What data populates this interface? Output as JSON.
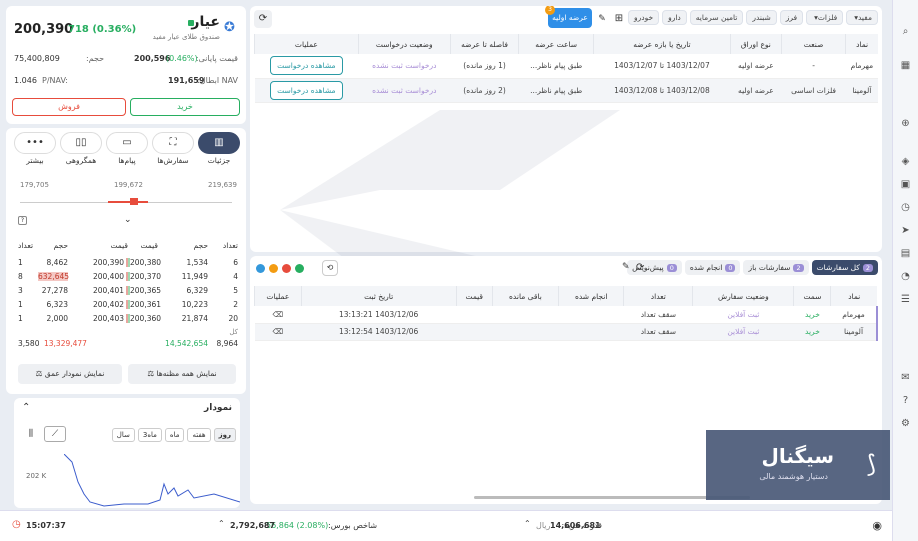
{
  "instrument": {
    "name": "عیار",
    "subtitle": "صندوق طلای عیار مفید",
    "price": "200,390",
    "change": "718 (0.36%)",
    "close_label": "قیمت پایانی:",
    "close_value": "200,596",
    "close_change": "(0.46%)",
    "volume_label": "حجم:",
    "volume_value": "75,400,809",
    "nav_label": "NAV ابطال:",
    "nav_value": "191,659",
    "pnav_label": "P/NAV:",
    "pnav_value": "1.046",
    "buy": "خرید",
    "sell": "فروش"
  },
  "tabs": [
    {
      "label": "جزئیات"
    },
    {
      "label": "سفارش‌ها"
    },
    {
      "label": "پیام‌ها"
    },
    {
      "label": "همگروهی"
    },
    {
      "label": "بیشتر"
    }
  ],
  "range": {
    "low": "179,705",
    "mid": "199,672",
    "high": "219,639"
  },
  "orderbook": {
    "headers": [
      "تعداد",
      "حجم",
      "قیمت",
      "قیمت",
      "حجم",
      "تعداد"
    ],
    "rows": [
      [
        "6",
        "1,534",
        "200,380",
        "200,390",
        "8,462",
        "1"
      ],
      [
        "4",
        "11,949",
        "200,370",
        "200,400",
        "632,645",
        "8"
      ],
      [
        "5",
        "6,329",
        "200,365",
        "200,401",
        "27,278",
        "3"
      ],
      [
        "2",
        "10,223",
        "200,361",
        "200,402",
        "6,323",
        "1"
      ],
      [
        "20",
        "21,874",
        "200,360",
        "200,403",
        "2,000",
        "1"
      ]
    ],
    "total_label": "کل",
    "total_buy_count": "8,964",
    "total_buy_vol": "14,542,654",
    "total_sell_vol": "13,329,477",
    "total_sell_count": "3,580",
    "btn_all": "نمایش همه مظنه‌ها",
    "btn_depth": "نمایش نمودار عمق"
  },
  "chart": {
    "title": "نمودار",
    "ranges": [
      "روز",
      "هفته",
      "ماه",
      "3ماه",
      "سال"
    ],
    "ylabel": "202 K"
  },
  "toolbar": {
    "buttons": [
      "مفید",
      "فلزات",
      "فرز",
      "شبندر",
      "تامین سرمایه",
      "دارو",
      "خودرو"
    ],
    "active": "عرضه اولیه",
    "badge": "3"
  },
  "ipo": {
    "headers": [
      "نماد",
      "صنعت",
      "نوع اوراق",
      "تاریخ یا بازه عرضه",
      "ساعت عرضه",
      "فاصله تا عرضه",
      "وضعیت درخواست",
      "عملیات"
    ],
    "rows": [
      [
        "مهرمام",
        "-",
        "عرضه اولیه",
        "1403/12/07 تا 1403/12/07",
        "طبق پیام ناظر...",
        "(1 روز مانده)",
        "درخواست ثبت نشده",
        "مشاهده درخواست"
      ],
      [
        "آلومینا",
        "فلزات اساسی",
        "عرضه اولیه",
        "1403/12/08 تا 1403/12/08",
        "طبق پیام ناظر...",
        "(2 روز مانده)",
        "درخواست ثبت نشده",
        "مشاهده درخواست"
      ]
    ]
  },
  "orders": {
    "tabs": [
      {
        "label": "کل سفارشات",
        "count": "2"
      },
      {
        "label": "سفارشات باز",
        "count": "2"
      },
      {
        "label": "انجام شده",
        "count": "0"
      },
      {
        "label": "پیش‌نویس",
        "count": "0"
      }
    ],
    "headers": [
      "نماد",
      "سمت",
      "وضعیت سفارش",
      "تعداد",
      "انجام شده",
      "باقی مانده",
      "قیمت",
      "تاریخ ثبت",
      "عملیات"
    ],
    "rows": [
      [
        "مهرمام",
        "خرید",
        "ثبت آفلاین",
        "سقف تعداد",
        "",
        "",
        "",
        "1403/12/06 13:13:21"
      ],
      [
        "آلومینا",
        "خرید",
        "ثبت آفلاین",
        "سقف تعداد",
        "",
        "",
        "",
        "1403/12/06 13:12:54"
      ]
    ]
  },
  "status": {
    "power_label": "قدرت خرید:",
    "power_value": "14,606,681",
    "currency": "ریال",
    "index_label": "شاخص بورس:",
    "index_value": "2,792,687",
    "index_change": "56,864 (2.08%)",
    "time": "15:07:37"
  },
  "brand": {
    "name": "سیگنال",
    "tagline": "دستیار هوشمند مالی"
  },
  "colors": {
    "accent": "#2a9aa5",
    "buy": "#27ae60",
    "sell": "#e74c3c",
    "brand_bg": "#3b4b6b"
  }
}
